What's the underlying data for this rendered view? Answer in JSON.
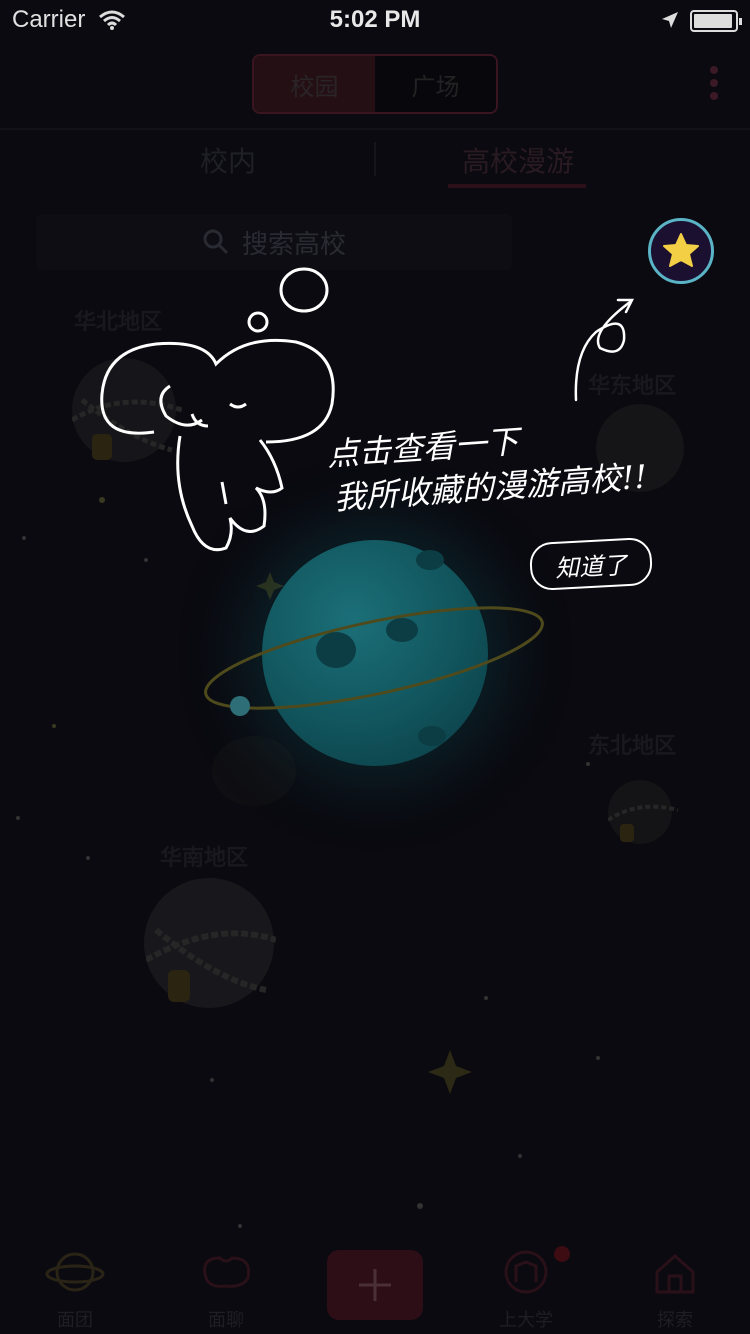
{
  "status_bar": {
    "carrier": "Carrier",
    "time": "5:02 PM"
  },
  "header": {
    "segments": [
      "校园",
      "广场"
    ],
    "active_segment": 0
  },
  "sub_tabs": {
    "left": "校内",
    "right": "高校漫游",
    "active": "right"
  },
  "search": {
    "placeholder": "搜索高校"
  },
  "regions": {
    "north": "华北地区",
    "east": "华东地区",
    "northeast": "东北地区",
    "south": "华南地区"
  },
  "guide": {
    "line1": "点击查看一下",
    "line2": "我所收藏的漫游高校!!",
    "dismiss": "知道了"
  },
  "tabbar": {
    "items": [
      "面团",
      "面聊",
      "上大学",
      "探索"
    ],
    "add_icon": "plus-icon"
  },
  "colors": {
    "accent": "#5ab4c6",
    "star": "#f3cf45",
    "overlay": "#0a0a10"
  }
}
